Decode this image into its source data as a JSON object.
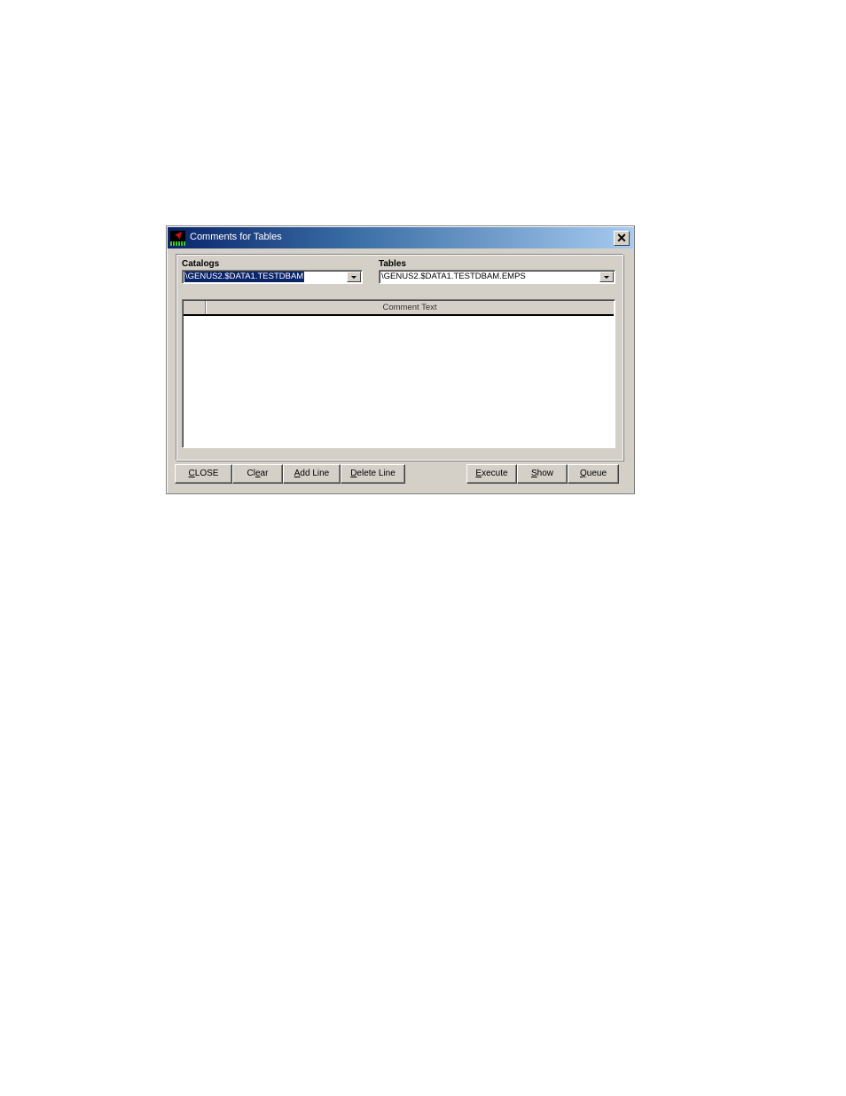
{
  "window": {
    "title": "Comments for Tables",
    "icon": "app-logo-icon",
    "close_icon": "close-icon"
  },
  "catalogs": {
    "label": "Catalogs",
    "value": "\\GENUS2.$DATA1.TESTDBAM"
  },
  "tables": {
    "label": "Tables",
    "value": "\\GENUS2.$DATA1.TESTDBAM.EMPS"
  },
  "grid": {
    "columns": [
      "Comment Text"
    ],
    "rows": []
  },
  "buttons": {
    "close": {
      "label": "CLOSE",
      "mnemonic": "C"
    },
    "clear": {
      "label": "Clear",
      "mnemonic": "e"
    },
    "add_line": {
      "label": "Add Line",
      "mnemonic": "A"
    },
    "delete_line": {
      "label": "Delete Line",
      "mnemonic": "D"
    },
    "execute": {
      "label": "Execute",
      "mnemonic": "E"
    },
    "show": {
      "label": "Show",
      "mnemonic": "S"
    },
    "queue": {
      "label": "Queue",
      "mnemonic": "Q"
    }
  }
}
